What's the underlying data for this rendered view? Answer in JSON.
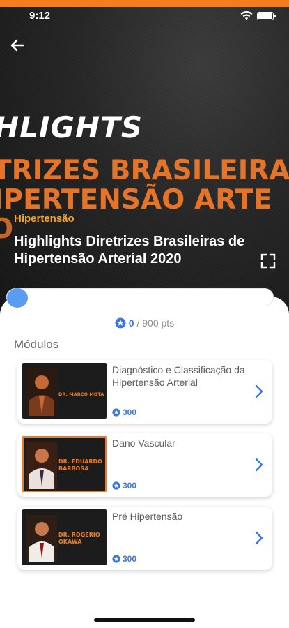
{
  "status_bar": {
    "time": "9:12"
  },
  "colors": {
    "accent_orange": "#f57c1f",
    "category_yellow": "#f4a62a",
    "link_blue": "#3b78d8",
    "progress_knob": "#5b9cf3"
  },
  "icons": {
    "back": "arrow-left-icon",
    "fullscreen": "fullscreen-icon",
    "star": "star-badge-icon",
    "chevron": "chevron-right-icon"
  },
  "hero": {
    "banner": {
      "word": "HLIGHTS",
      "line1": "TRIZES BRASILEIRA",
      "line2": "IPERTENSÃO ARTE",
      "line3": "O"
    },
    "category": "Hipertensão",
    "title": "Highlights Diretrizes Brasileiras de Hipertensão Arterial 2020"
  },
  "progress": {
    "fraction": 0.0
  },
  "points": {
    "earned": "0",
    "total": "/ 900 pts"
  },
  "modules_heading": "Módulos",
  "modules": [
    {
      "title": "Diagnóstico e Classificação da Hipertensão Arterial",
      "points": "300",
      "thumb_label": "DR. MARCO MOTA"
    },
    {
      "title": "Dano Vascular",
      "points": "300",
      "thumb_label_1": "DR. EDUARDO",
      "thumb_label_2": "BARBOSA"
    },
    {
      "title": "Pré Hipertensão",
      "points": "300",
      "thumb_label_1": "DR. ROGERIO",
      "thumb_label_2": "OKAWA"
    }
  ]
}
